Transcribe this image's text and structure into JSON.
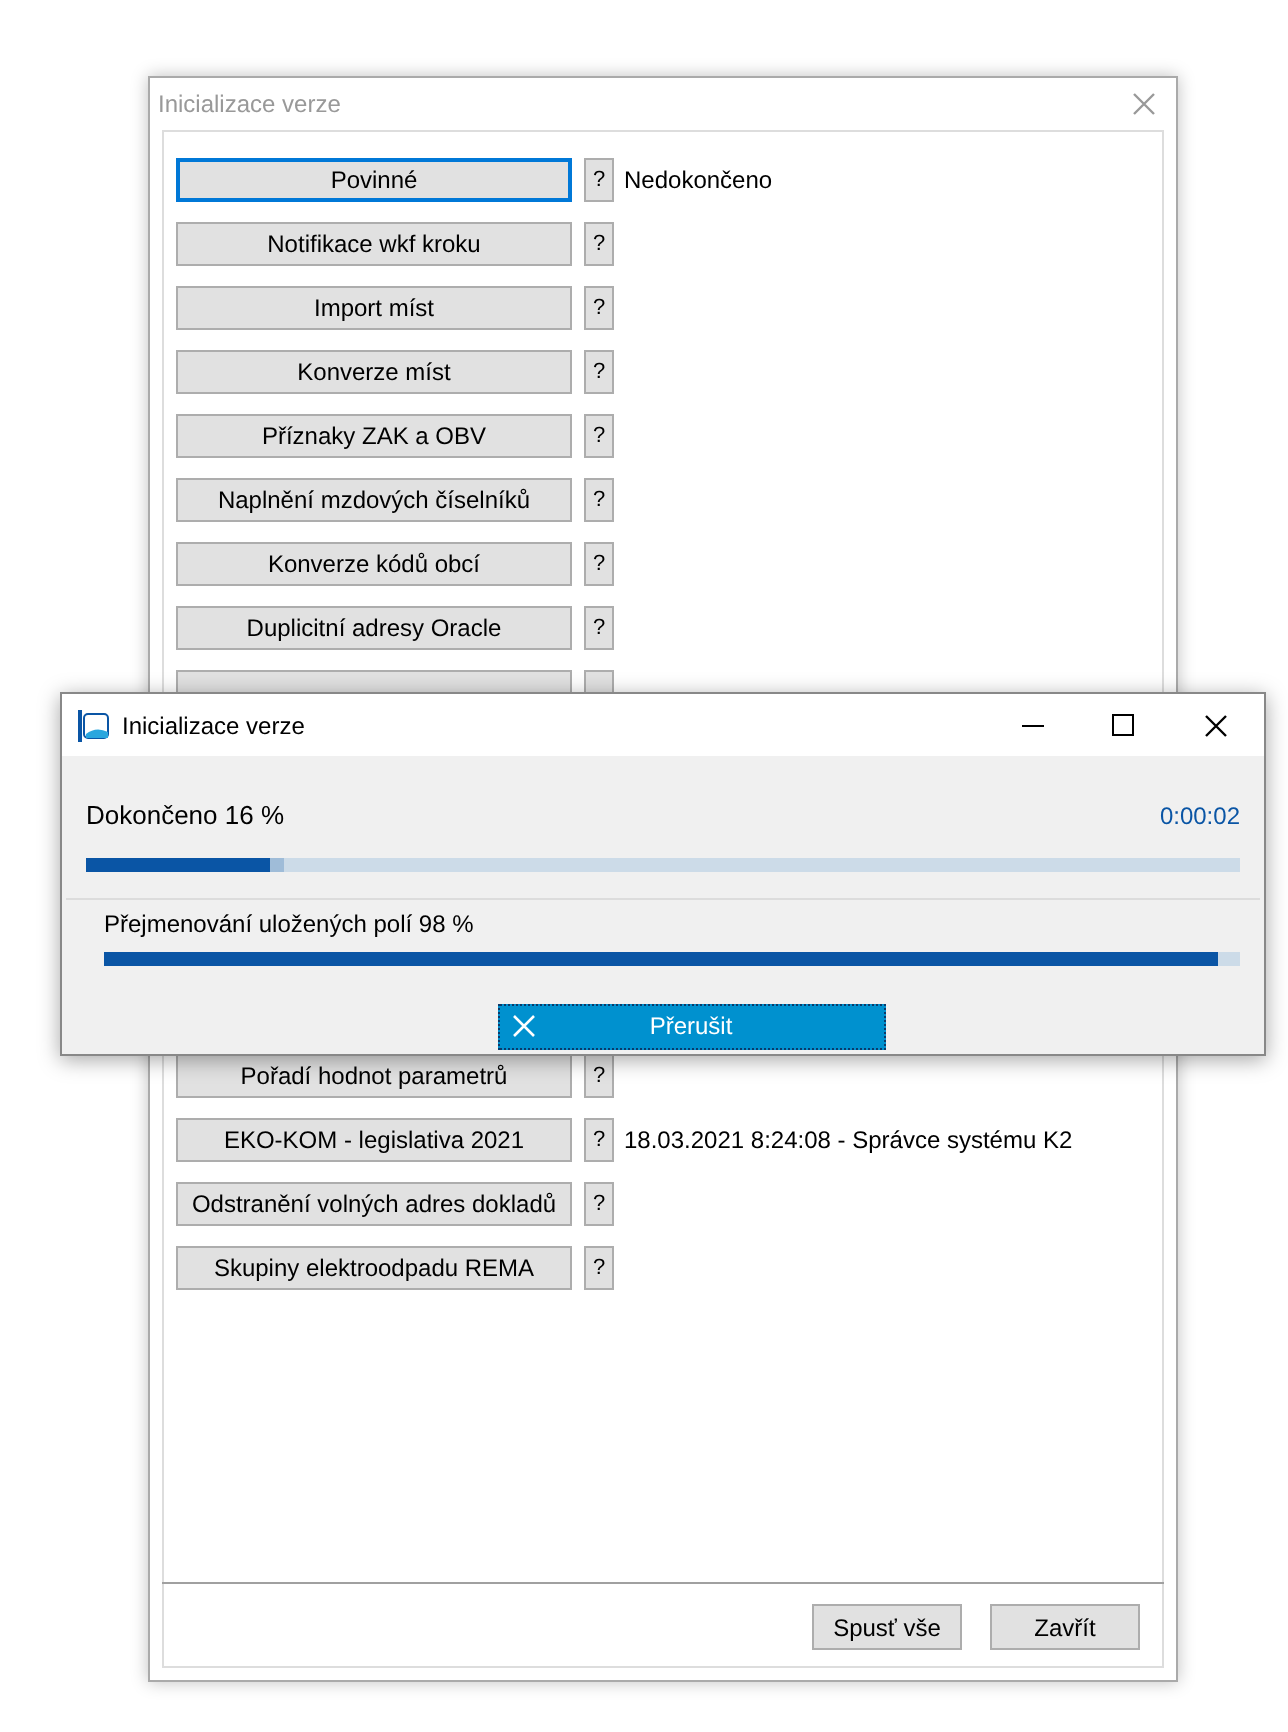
{
  "main_window": {
    "title": "Inicializace verze",
    "rows_above": [
      {
        "label": "Povinné",
        "focused": true,
        "help": "?",
        "status": "Nedokončeno"
      },
      {
        "label": "Notifikace wkf kroku",
        "focused": false,
        "help": "?"
      },
      {
        "label": "Import míst",
        "focused": false,
        "help": "?"
      },
      {
        "label": "Konverze míst",
        "focused": false,
        "help": "?"
      },
      {
        "label": "Příznaky ZAK a OBV",
        "focused": false,
        "help": "?"
      },
      {
        "label": "Naplnění mzdových číselníků",
        "focused": false,
        "help": "?"
      },
      {
        "label": "Konverze kódů obcí",
        "focused": false,
        "help": "?"
      },
      {
        "label": "Duplicitní adresy Oracle",
        "focused": false,
        "help": "?"
      },
      {
        "focused": false
      }
    ],
    "rows_below": [
      {
        "label": "Pořadí hodnot parametrů",
        "focused": false,
        "help": "?"
      },
      {
        "label": "EKO-KOM - legislativa 2021",
        "focused": false,
        "help": "?",
        "status": "18.03.2021 8:24:08 - Správce systému K2"
      },
      {
        "label": "Odstranění volných adres dokladů",
        "focused": false,
        "help": "?"
      },
      {
        "label": "Skupiny elektroodpadu REMA",
        "focused": false,
        "help": "?"
      }
    ],
    "buttons": [
      "Spusť vše",
      "Zavřít"
    ]
  },
  "progress_dialog": {
    "title": "Inicializace verze",
    "overall_label": "Dokončeno 16 %",
    "elapsed": "0:00:02",
    "overall": {
      "level": 0.16
    },
    "step_label": "Přejmenování uložených polí 98 %",
    "step": {
      "level": 0.98
    },
    "cancel_button": "Přerušit"
  }
}
